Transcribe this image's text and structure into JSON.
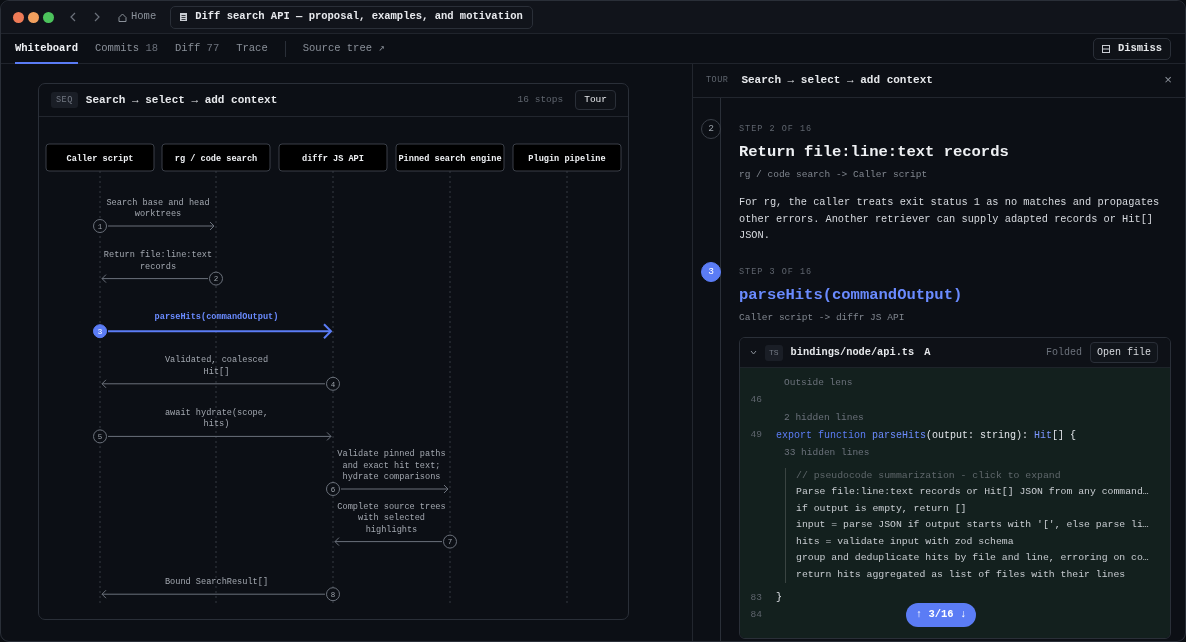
{
  "window": {
    "lights": [
      {
        "color": "#ee7b57"
      },
      {
        "color": "#f2a05e"
      },
      {
        "color": "#4cc35c"
      }
    ],
    "home": "Home",
    "document_title": "Diff search API — proposal, examples, and motivation"
  },
  "tabs": [
    {
      "label": "Whiteboard",
      "selected": true
    },
    {
      "label": "Commits",
      "count": "18",
      "selected": false
    },
    {
      "label": "Diff",
      "count": "77",
      "selected": false
    },
    {
      "label": "Trace",
      "selected": false
    }
  ],
  "source_link": "Source tree ↗",
  "dismiss_button": "Dismiss",
  "diagram": {
    "badge": "SEQ",
    "title": "Search → select → add context",
    "stops": "16 stops",
    "tour_button": "Tour",
    "participants": [
      "Caller script",
      "rg / code search",
      "diffr JS API",
      "Pinned search engine",
      "Plugin pipeline"
    ],
    "messages": [
      {
        "step": "1",
        "label_lines": [
          "Search base and head",
          "worktrees"
        ],
        "selected": false
      },
      {
        "step": "2",
        "label_lines": [
          "Return file:line:text",
          "records"
        ],
        "selected": false
      },
      {
        "step": "3",
        "label_lines": [
          "parseHits(commandOutput)"
        ],
        "selected": true
      },
      {
        "step": "4",
        "label_lines": [
          "Validated, coalesced",
          "Hit[]"
        ],
        "selected": false
      },
      {
        "step": "5",
        "label_lines": [
          "await hydrate(scope,",
          "hits)"
        ],
        "selected": false
      },
      {
        "step": "6",
        "label_lines": [
          "Validate pinned paths",
          "and exact hit text;",
          "hydrate comparisons"
        ],
        "selected": false
      },
      {
        "step": "7",
        "label_lines": [
          "Complete source trees",
          "with selected",
          "highlights"
        ],
        "selected": false
      },
      {
        "step": "8",
        "label_lines": [
          "Bound SearchResult[]"
        ],
        "selected": false
      }
    ]
  },
  "tour": {
    "badge": "TOUR",
    "title": "Search → select → add context",
    "close": "×",
    "steps": [
      {
        "number": "2",
        "label": "STEP 2 OF 16",
        "title": "Return file:line:text records",
        "route": "rg / code search -> Caller script",
        "body": "For rg, the caller treats exit status 1 as no matches and propagates other errors. Another retriever can supply adapted records or Hit[] JSON.",
        "selected": false
      },
      {
        "number": "3",
        "label": "STEP 3 OF 16",
        "title": "parseHits(commandOutput)",
        "route": "Caller script -> diffr JS API",
        "selected": true,
        "file": {
          "lang": "TS",
          "path": "bindings/node/api.ts",
          "status": "A",
          "mode": "Folded",
          "open_button": "Open file",
          "lines": [
            {
              "kind": "note",
              "text": "Outside lens"
            },
            {
              "kind": "code",
              "number": "46"
            },
            {
              "kind": "note",
              "text": "2 hidden lines"
            },
            {
              "kind": "code",
              "number": "49",
              "tokens": [
                {
                  "kind": "keyword",
                  "text": "export "
                },
                {
                  "kind": "keyword",
                  "text": "function "
                },
                {
                  "kind": "function",
                  "text": "parseHits"
                },
                {
                  "kind": "plain",
                  "text": "(output: string): "
                },
                {
                  "kind": "type",
                  "text": "Hit"
                },
                {
                  "kind": "plain",
                  "text": "[] {"
                }
              ]
            },
            {
              "kind": "note",
              "text": "33 hidden lines"
            },
            {
              "kind": "summary",
              "comment": "// pseudocode summarization - click to expand",
              "lines": [
                "Parse file:line:text records or Hit[] JSON from any command…",
                "if output is empty, return []",
                "input = parse JSON if output starts with '[', else parse li…",
                "hits = validate input with zod schema",
                "group and deduplicate hits by file and line, erroring on co…",
                "return hits aggregated as list of files with their lines"
              ]
            },
            {
              "kind": "code",
              "number": "83",
              "tokens": [
                {
                  "kind": "plain",
                  "text": "}"
                }
              ]
            },
            {
              "kind": "code",
              "number": "84"
            }
          ]
        }
      }
    ],
    "pager": "↑ 3/16 ↓"
  }
}
